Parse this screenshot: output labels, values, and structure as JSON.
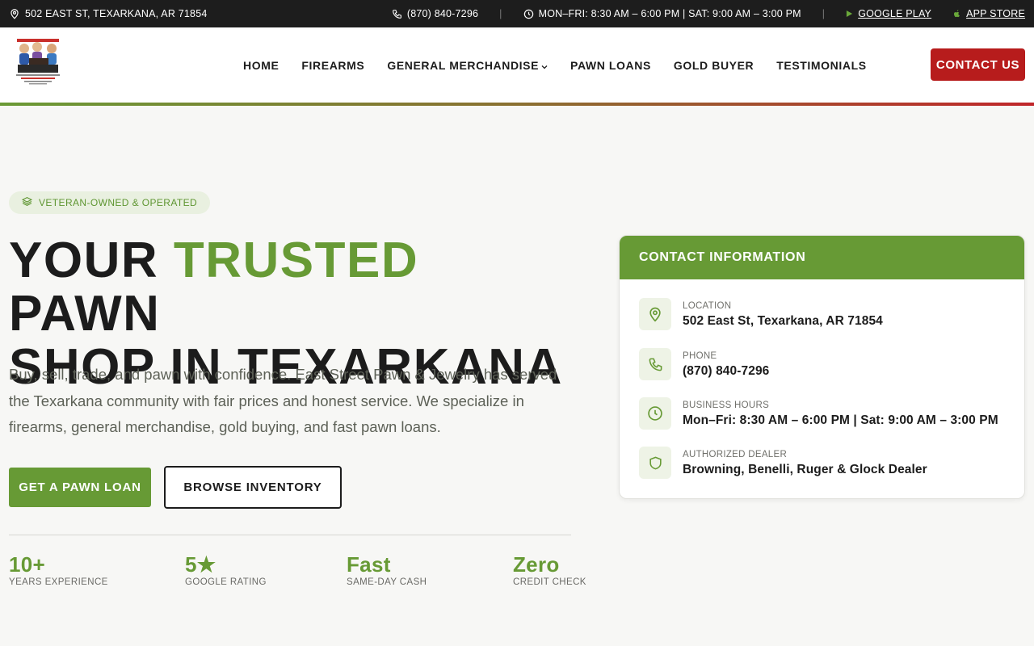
{
  "topbar": {
    "address": "502 EAST ST, TEXARKANA, AR 71854",
    "phone": "(870) 840-7296",
    "hours": "MON–FRI: 8:30 AM – 6:00 PM | SAT: 9:00 AM – 3:00 PM",
    "separator": "|",
    "google_play": "GOOGLE PLAY",
    "app_store": "APP STORE",
    "icons": [
      "location-pin-icon",
      "phone-icon",
      "clock-icon",
      "play-icon",
      "apple-icon"
    ]
  },
  "header": {
    "nav": [
      {
        "label": "HOME"
      },
      {
        "label": "FIREARMS"
      },
      {
        "label": "GENERAL MERCHANDISE",
        "has_dropdown": true
      },
      {
        "label": "PAWN LOANS"
      },
      {
        "label": "GOLD BUYER"
      },
      {
        "label": "TESTIMONIALS"
      }
    ],
    "contact_button": "CONTACT US"
  },
  "hero": {
    "badge": "VETERAN-OWNED & OPERATED",
    "headline_1": "YOUR ",
    "headline_highlight": "TRUSTED",
    "headline_2": " PAWN",
    "headline_3": "SHOP IN TEXARKANA",
    "description": "Buy, sell, trade, and pawn with confidence. East Street Pawn & Jewelry has served the Texarkana community with fair prices and honest service. We specialize in firearms, general merchandise, gold buying, and fast pawn loans.",
    "primary_button": "GET A PAWN LOAN",
    "secondary_button": "BROWSE INVENTORY",
    "stats": [
      {
        "value": "10+",
        "label": "YEARS EXPERIENCE"
      },
      {
        "value": "5★",
        "label": "GOOGLE RATING"
      },
      {
        "value": "Fast",
        "label": "SAME-DAY CASH"
      },
      {
        "value": "Zero",
        "label": "CREDIT CHECK"
      }
    ]
  },
  "contact_card": {
    "title": "CONTACT INFORMATION",
    "items": [
      {
        "icon": "location-pin-icon",
        "label": "LOCATION",
        "value": "502 East St, Texarkana, AR 71854"
      },
      {
        "icon": "phone-icon",
        "label": "PHONE",
        "value": "(870) 840-7296"
      },
      {
        "icon": "clock-icon",
        "label": "BUSINESS HOURS",
        "value": "Mon–Fri: 8:30 AM – 6:00 PM | Sat: 9:00 AM – 3:00 PM"
      },
      {
        "icon": "shield-icon",
        "label": "AUTHORIZED DEALER",
        "value": "Browning, Benelli, Ruger & Glock Dealer"
      }
    ]
  },
  "colors": {
    "brand_green": "#679a35",
    "brand_red": "#b71c1c",
    "topbar_bg": "#1d1d1d",
    "page_bg": "#f7f7f5"
  }
}
